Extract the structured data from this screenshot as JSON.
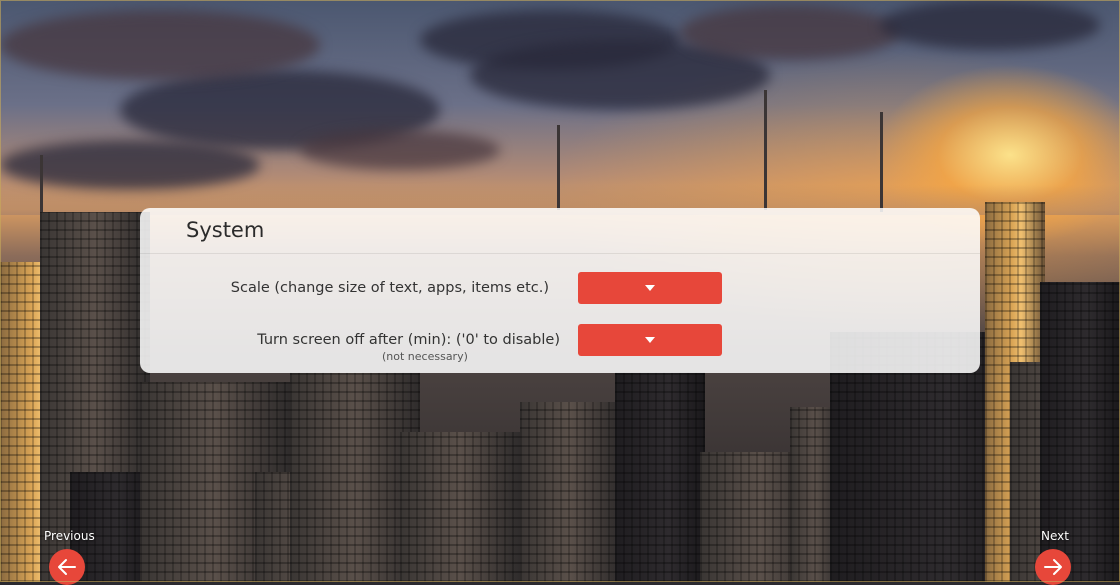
{
  "settings": {
    "title": "System",
    "scale": {
      "label": "Scale (change size of text, apps, items etc.)",
      "value": ""
    },
    "screen_off": {
      "label": "Turn screen off after (min): ('0' to disable)",
      "note": "(not necessary)",
      "value": ""
    }
  },
  "navigation": {
    "previous_label": "Previous",
    "next_label": "Next"
  },
  "icons": {
    "dropdown": "caret-down-icon",
    "previous": "arrow-left-icon",
    "next": "arrow-right-icon"
  },
  "colors": {
    "accent": "#e7473a",
    "card_background": "#ffffff",
    "text": "#333333"
  }
}
